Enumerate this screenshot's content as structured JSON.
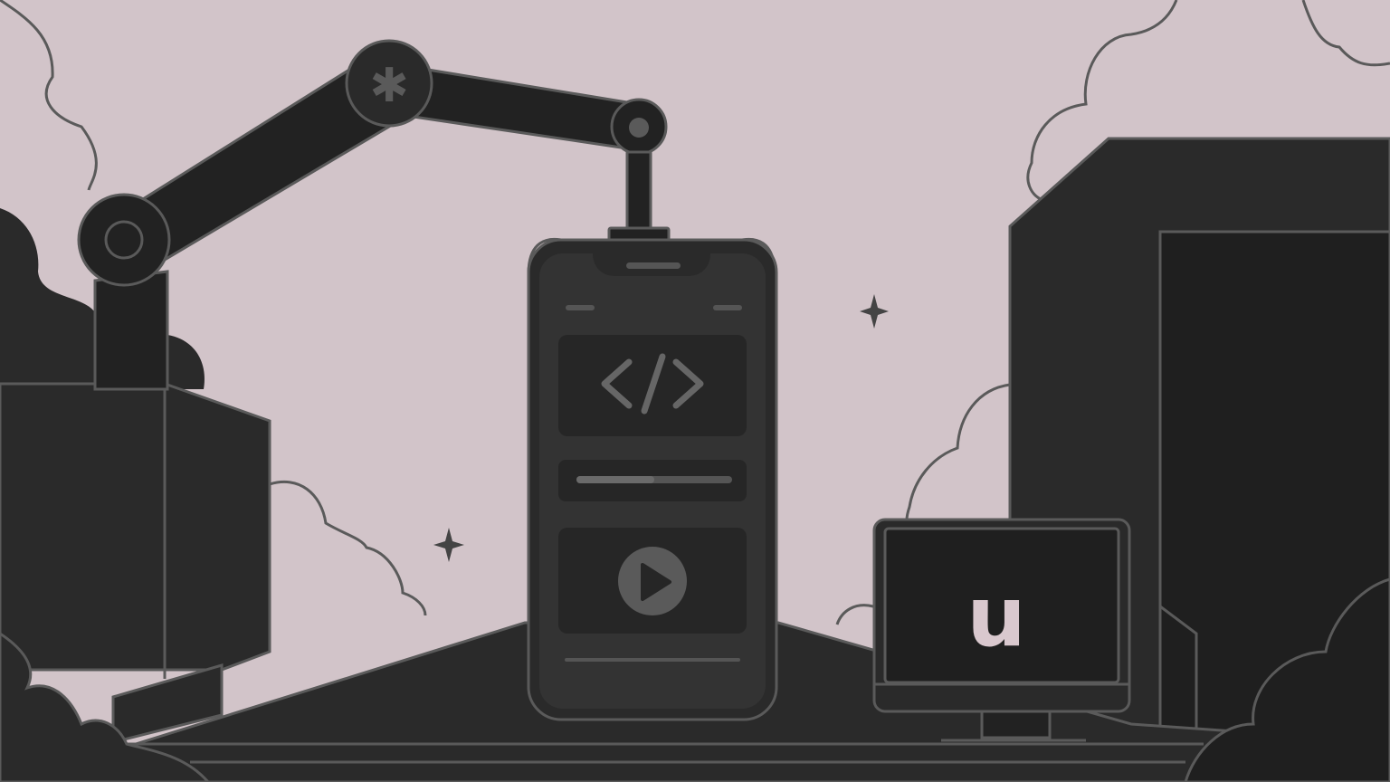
{
  "scene": {
    "description_hidden": false,
    "colors": {
      "sky": "#d2c4c9",
      "silhouette": "#2a2a2a",
      "dark": "#1f1f1f",
      "outline": "#5a5a5a",
      "panel": "#333333",
      "accent": "#d9c8ce"
    }
  },
  "phone": {
    "code_icon": "code-brackets-icon",
    "play_icon": "play-icon",
    "progress": 0.5
  },
  "monitor": {
    "letter": "u"
  },
  "icons": [
    "gear-icon",
    "sparkle-icon",
    "atom-orbit-icon",
    "cloud-icon",
    "robot-arm-icon"
  ]
}
